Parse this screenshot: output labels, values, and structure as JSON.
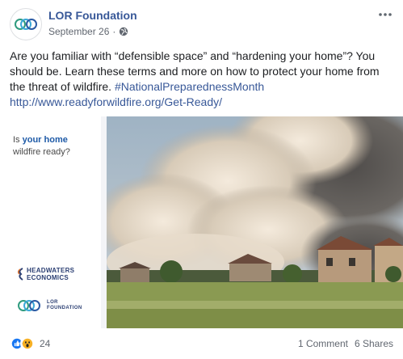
{
  "post": {
    "page_name": "LOR Foundation",
    "date": "September 26",
    "separator": "·",
    "body_text": "Are you familiar with “defensible space” and “hardening your home”? You should be. Learn these terms and more on how to protect your home from the threat of wildfire.",
    "hashtag": "#NationalPreparednessMonth",
    "link": "http://www.readyforwildfire.org/Get-Ready/"
  },
  "image_panel": {
    "question_prefix": "Is ",
    "question_highlight": "your home",
    "question_suffix": "wildfire ready?",
    "partner_logo_line1": "HEADWATERS",
    "partner_logo_line2": "ECONOMICS",
    "lor_logo_line1": "LOR",
    "lor_logo_line2": "FOUNDATION"
  },
  "footer": {
    "reaction_count": "24",
    "comments": "1 Comment",
    "shares": "6 Shares"
  },
  "icons": {
    "more": "more-options-icon",
    "privacy": "globe-icon",
    "like": "like-reaction-icon",
    "wow": "wow-reaction-icon"
  },
  "colors": {
    "link": "#385898",
    "accent": "#1e5aa7",
    "like": "#1877f2",
    "wow": "#f7b125"
  }
}
